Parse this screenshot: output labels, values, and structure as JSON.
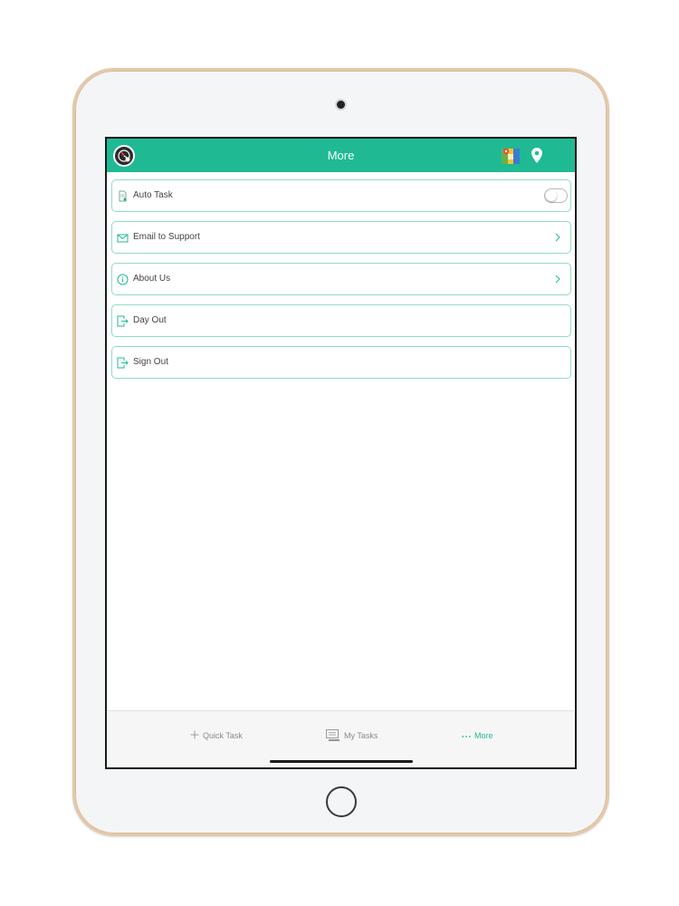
{
  "navbar": {
    "title": "More",
    "icons": [
      "app-logo-icon",
      "map-icon",
      "location-pin-icon"
    ]
  },
  "settings": {
    "items": [
      {
        "label": "Auto Task",
        "icon": "document-icon",
        "control": "toggle",
        "enabled": false
      },
      {
        "label": "Email to Support",
        "icon": "mail-icon",
        "control": "chevron"
      },
      {
        "label": "About Us",
        "icon": "info-icon",
        "control": "chevron"
      },
      {
        "label": "Day Out",
        "icon": "exit-icon",
        "control": "none"
      },
      {
        "label": "Sign Out",
        "icon": "exit-icon",
        "control": "none"
      }
    ]
  },
  "tabbar": {
    "tabs": [
      {
        "label": "Quick Task",
        "icon": "plus-icon",
        "active": false
      },
      {
        "label": "My Tasks",
        "icon": "tasks-icon",
        "active": false
      },
      {
        "label": "More",
        "icon": "more-dots-icon",
        "active": true
      }
    ]
  },
  "colors": {
    "accent": "#1fba94",
    "row_border": "#8fdcc6",
    "device_frame": "#e3c9ab"
  }
}
